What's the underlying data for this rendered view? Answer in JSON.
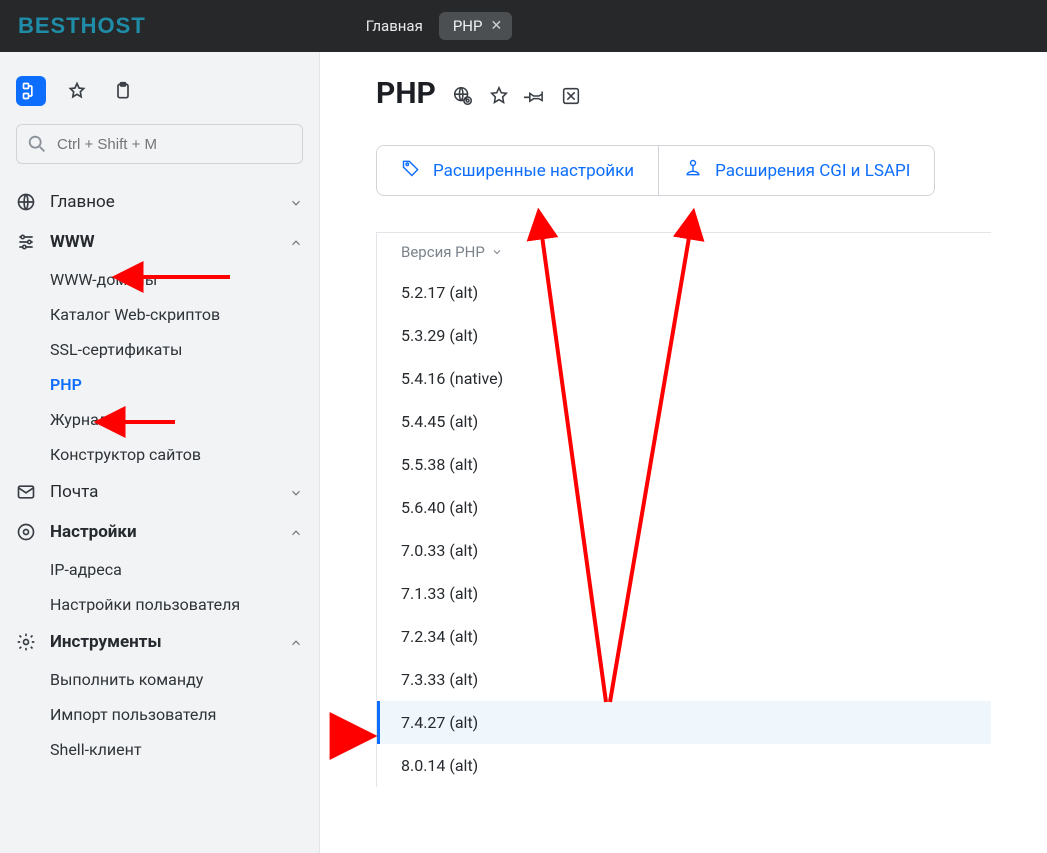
{
  "brand": "BESTHOST",
  "topbar": {
    "home_label": "Главная",
    "active_tab_label": "PHP"
  },
  "sidebar": {
    "search_placeholder": "Ctrl + Shift + M",
    "groups": [
      {
        "id": "main",
        "label": "Главное",
        "expanded": false,
        "has_icon": "globe"
      },
      {
        "id": "www",
        "label": "WWW",
        "expanded": true,
        "has_icon": "sliders",
        "items": [
          {
            "id": "domains",
            "label": "WWW-домены"
          },
          {
            "id": "catalog",
            "label": "Каталог Web-скриптов"
          },
          {
            "id": "ssl",
            "label": "SSL-сертификаты"
          },
          {
            "id": "php",
            "label": "PHP",
            "active": true
          },
          {
            "id": "logs",
            "label": "Журналы"
          },
          {
            "id": "builder",
            "label": "Конструктор сайтов"
          }
        ]
      },
      {
        "id": "mail",
        "label": "Почта",
        "expanded": false,
        "has_icon": "mail"
      },
      {
        "id": "settings",
        "label": "Настройки",
        "expanded": true,
        "has_icon": "toggle",
        "items": [
          {
            "id": "ip",
            "label": "IP-адреса"
          },
          {
            "id": "user",
            "label": "Настройки пользователя"
          }
        ]
      },
      {
        "id": "tools",
        "label": "Инструменты",
        "expanded": true,
        "has_icon": "gear",
        "items": [
          {
            "id": "cmd",
            "label": "Выполнить команду"
          },
          {
            "id": "import",
            "label": "Импорт пользователя"
          },
          {
            "id": "shell",
            "label": "Shell-клиент"
          }
        ]
      }
    ]
  },
  "page": {
    "title": "PHP",
    "buttons": {
      "advanced": "Расширенные настройки",
      "cgi": "Расширения CGI и LSAPI"
    },
    "table": {
      "column_header": "Версия PHP",
      "selected_index": 10,
      "rows": [
        "5.2.17 (alt)",
        "5.3.29 (alt)",
        "5.4.16 (native)",
        "5.4.45 (alt)",
        "5.5.38 (alt)",
        "5.6.40 (alt)",
        "7.0.33 (alt)",
        "7.1.33 (alt)",
        "7.2.34 (alt)",
        "7.3.33 (alt)",
        "7.4.27 (alt)",
        "8.0.14 (alt)"
      ]
    }
  }
}
